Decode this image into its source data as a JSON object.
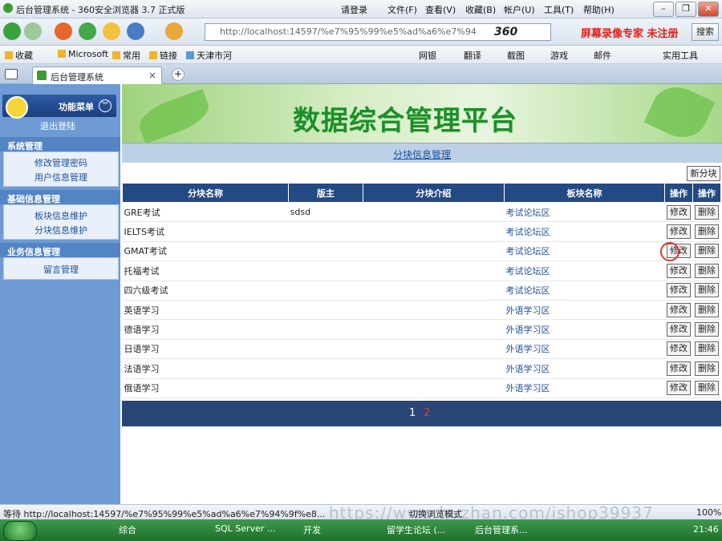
{
  "window": {
    "title": "后台管理系统 - 360安全浏览器 3.7 正式版",
    "login": "请登录",
    "menu": [
      "文件(F)",
      "查看(V)",
      "收藏(B)",
      "帐户(U)",
      "工具(T)",
      "帮助(H)"
    ]
  },
  "navbar": {
    "url": "http://localhost:14597/%e7%95%99%e5%ad%a6%e7%94",
    "brand": "360",
    "recorder_watermark": "屏幕录像专家 未注册",
    "search_label": "搜索"
  },
  "favorites": [
    "收藏",
    "Microsoft",
    "常用",
    "链接",
    "天津市河"
  ],
  "toolbar_right": [
    "网银",
    "翻译",
    "截图",
    "游戏",
    "邮件",
    "实用工具"
  ],
  "tab": {
    "label": "后台管理系统",
    "close": "×",
    "new": "+"
  },
  "sidebar": {
    "header": "功能菜单",
    "logout": "退出登陆",
    "groups": [
      {
        "title": "系统管理",
        "links": [
          "修改管理密码",
          "用户信息管理"
        ]
      },
      {
        "title": "基础信息管理",
        "links": [
          "板块信息维护",
          "分块信息维护"
        ]
      },
      {
        "title": "业务信息管理",
        "links": [
          "留言管理"
        ]
      }
    ]
  },
  "banner": {
    "title": "数据综合管理平台"
  },
  "section": {
    "title": "分块信息管理",
    "new_button": "新分块"
  },
  "table": {
    "headers": [
      "分块名称",
      "版主",
      "分块介绍",
      "板块名称",
      "操作",
      "操作"
    ],
    "edit_label": "修改",
    "delete_label": "删除",
    "rows": [
      {
        "name": "GRE考试",
        "moderator": "sdsd",
        "intro": "",
        "board": "考试论坛区"
      },
      {
        "name": "IELTS考试",
        "moderator": "",
        "intro": "",
        "board": "考试论坛区"
      },
      {
        "name": "GMAT考试",
        "moderator": "",
        "intro": "",
        "board": "考试论坛区"
      },
      {
        "name": "托福考试",
        "moderator": "",
        "intro": "",
        "board": "考试论坛区"
      },
      {
        "name": "四六级考试",
        "moderator": "",
        "intro": "",
        "board": "考试论坛区"
      },
      {
        "name": "英语学习",
        "moderator": "",
        "intro": "",
        "board": "外语学习区"
      },
      {
        "name": "德语学习",
        "moderator": "",
        "intro": "",
        "board": "外语学习区"
      },
      {
        "name": "日语学习",
        "moderator": "",
        "intro": "",
        "board": "外语学习区"
      },
      {
        "name": "法语学习",
        "moderator": "",
        "intro": "",
        "board": "外语学习区"
      },
      {
        "name": "俄语学习",
        "moderator": "",
        "intro": "",
        "board": "外语学习区"
      }
    ]
  },
  "pager": {
    "current": "1",
    "next": "2"
  },
  "statusbar": {
    "text": "等待 http://localhost:14597/%e7%95%99%e5%ad%a6%e7%94%9f%e8...",
    "watermark": "https://www.huzhan.com/ishop39937",
    "mode": "切换浏览模式",
    "zoom": "100%"
  },
  "taskbar": {
    "tasks": [
      "综合",
      "SQL Server ...",
      "开发",
      "留学生论坛 (...",
      "后台管理系..."
    ],
    "clock": "21:46"
  },
  "colors": {
    "table_header": "#244a84",
    "sidebar": "#6e9bd4",
    "banner_title": "#1b8f2c",
    "link": "#1d4d9c"
  }
}
